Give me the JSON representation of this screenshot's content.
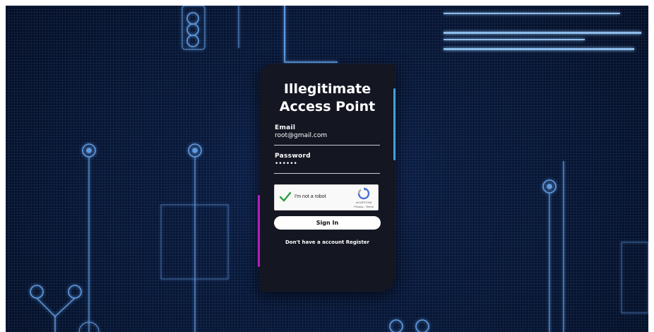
{
  "login": {
    "title_line1": "Illegitimate",
    "title_line2": "Access Point",
    "email_label": "Email",
    "email_value": "root@gmail.com",
    "password_label": "Password",
    "password_value": "••••••",
    "recaptcha": {
      "label": "I'm not a robot",
      "brand": "reCAPTCHA",
      "terms": "Privacy - Terms",
      "checked": true
    },
    "signin_label": "Sign In",
    "footer_text": "Don't have a account",
    "register_label": "Register"
  },
  "colors": {
    "card": "#141622",
    "accent_right": "#3fa3d8",
    "accent_left": "#b01fc0",
    "check": "#2e9e44"
  },
  "icons": {
    "check": "check-mark-icon",
    "recaptcha": "recaptcha-logo-icon"
  }
}
